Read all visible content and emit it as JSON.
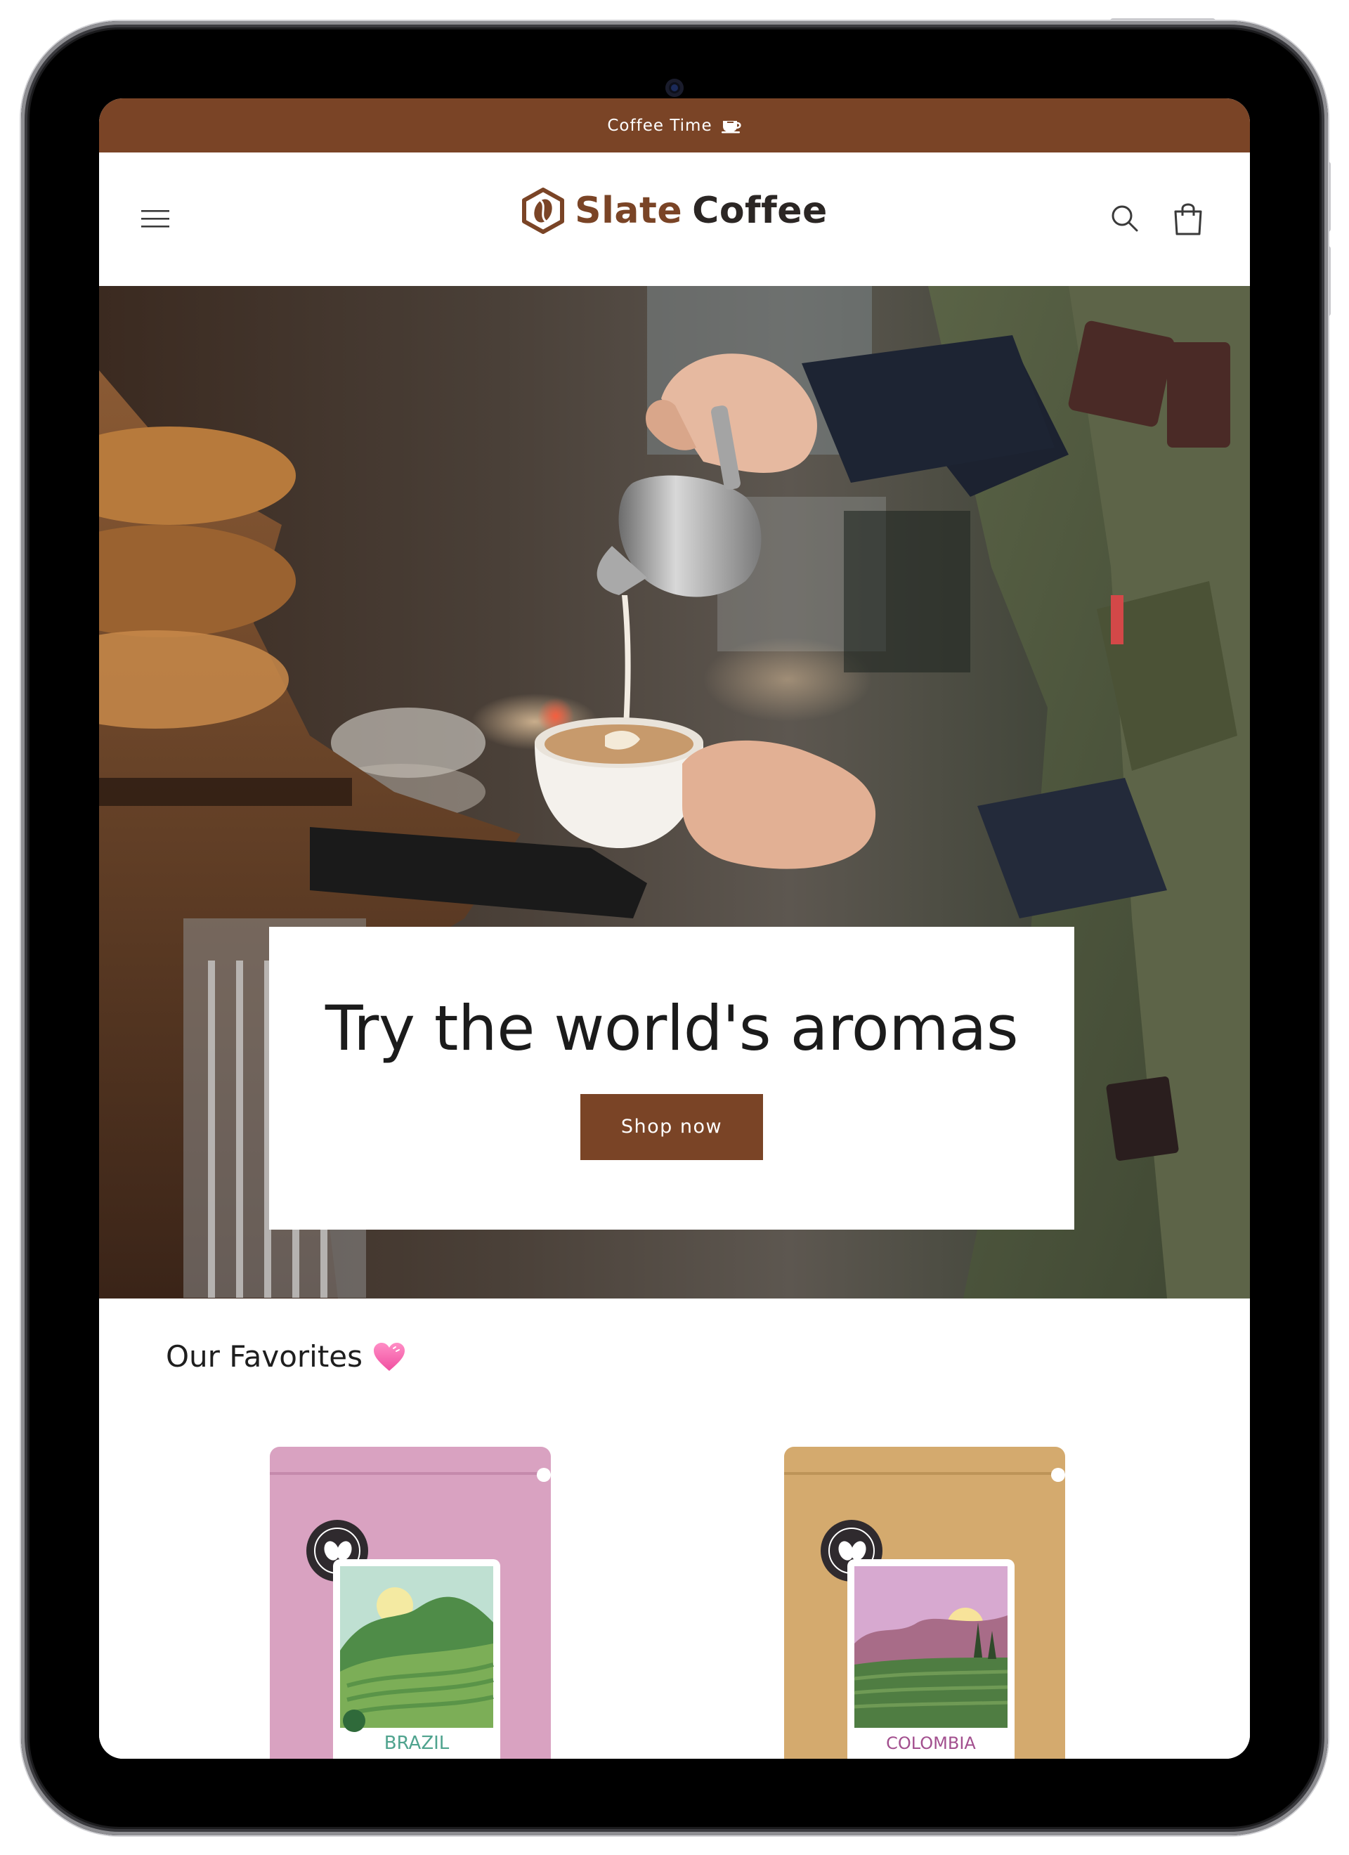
{
  "announcement": {
    "text": "Coffee Time"
  },
  "brand": {
    "name_part1": "Slate",
    "name_part2": "Coffee"
  },
  "hero": {
    "title": "Try the world's aromas",
    "cta_label": "Shop now"
  },
  "favorites": {
    "title": "Our Favorites",
    "products": [
      {
        "label": "BRAZIL"
      },
      {
        "label": "COLOMBIA"
      }
    ]
  },
  "icons": {
    "menu": "hamburger-icon",
    "search": "search-icon",
    "cart": "cart-icon",
    "logo": "coffee-bean-hexagon-icon",
    "announcement": "coffee-cup-icon",
    "favorites": "heart-icon"
  },
  "colors": {
    "brand": "#7a4426",
    "text_dark": "#1b1b1b",
    "bag_pink": "#d9a2c1",
    "bag_kraft": "#d4aa6e"
  }
}
